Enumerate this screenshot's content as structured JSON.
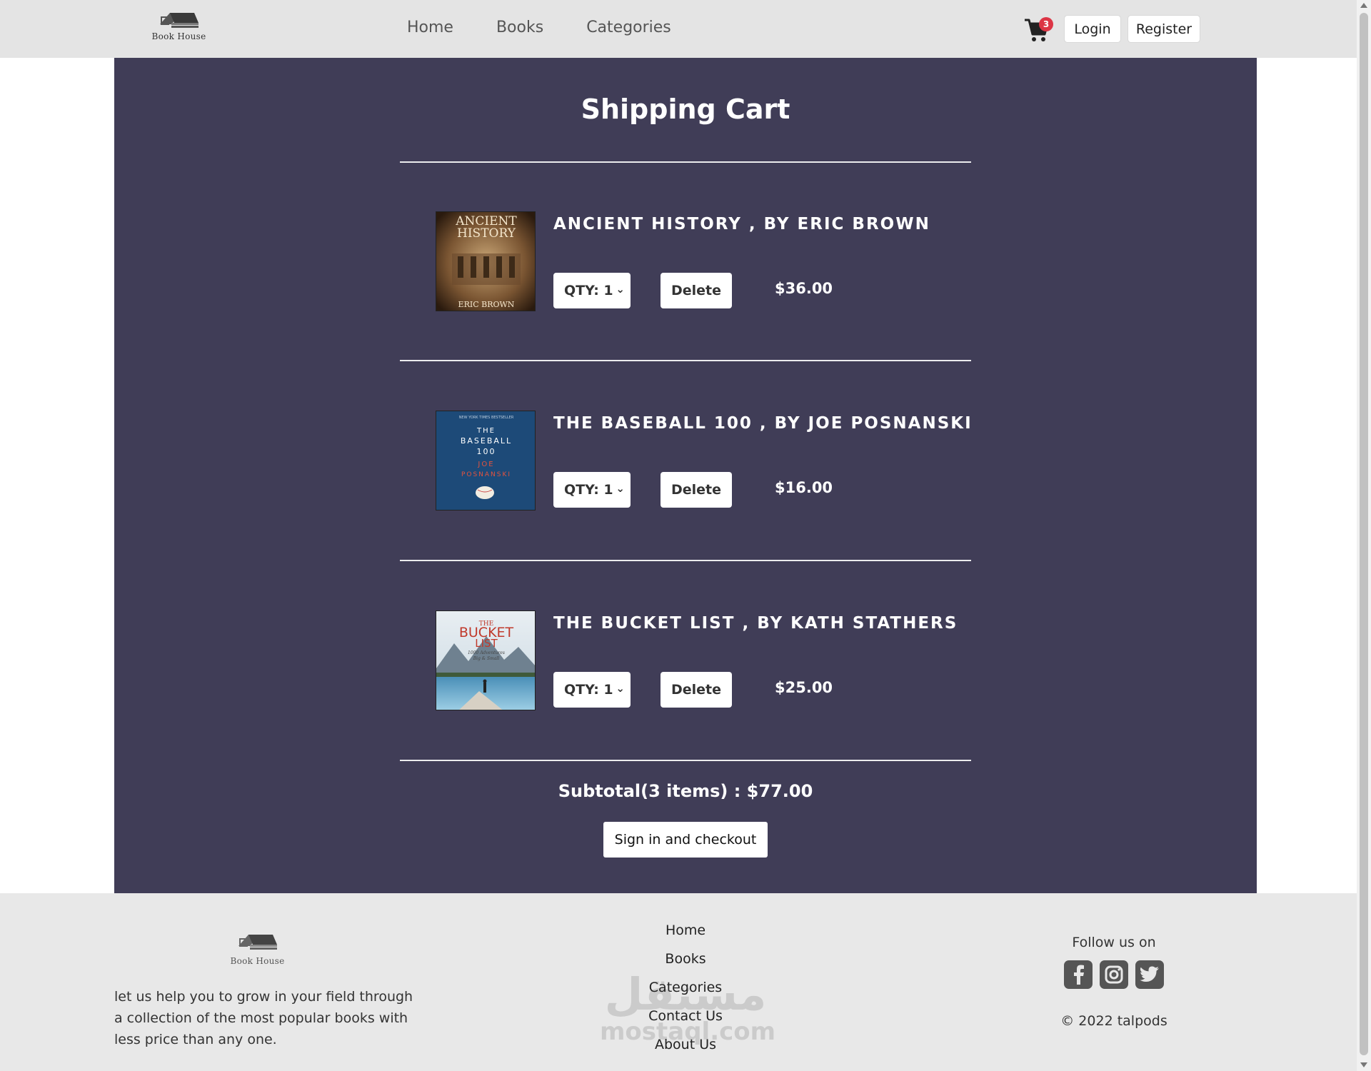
{
  "nav": {
    "brand": "Book House",
    "links": [
      "Home",
      "Books",
      "Categories"
    ],
    "cart_count": "3",
    "login_label": "Login",
    "register_label": "Register"
  },
  "cart": {
    "title": "Shipping Cart",
    "items": [
      {
        "title": "Ancient History , by Eric Brown",
        "qty_label": "QTY: 1",
        "delete_label": "Delete",
        "price": "$36.00",
        "cover": {
          "line1": "ANCIENT",
          "line2": "HISTORY",
          "author": "ERIC BROWN"
        }
      },
      {
        "title": "The Baseball 100 , by Joe Posnanski",
        "qty_label": "QTY: 1",
        "delete_label": "Delete",
        "price": "$16.00",
        "cover": {
          "top": "NEW YORK TIMES BESTSELLER",
          "line1": "THE",
          "line2": "BASEBALL",
          "line3": "100",
          "author1": "JOE",
          "author2": "POSNANSKI"
        }
      },
      {
        "title": "The Bucket List , by Kath Stathers",
        "qty_label": "QTY: 1",
        "delete_label": "Delete",
        "price": "$25.00",
        "cover": {
          "line1": "THE",
          "line2": "BUCKET",
          "line3": "LIST",
          "sub1": "1000 Adventures",
          "sub2": "Big & Small"
        }
      }
    ],
    "subtotal": "Subtotal(3 items) : $77.00",
    "checkout_label": "Sign in and checkout"
  },
  "footer": {
    "brand": "Book House",
    "about": "let us help you to grow in your field through a collection of the most popular books with less price than any one.",
    "links": [
      "Home",
      "Books",
      "Categories",
      "Contact Us",
      "About Us"
    ],
    "follow": "Follow us on",
    "copyright": "© 2022 talpods",
    "watermark_ar": "مستقل",
    "watermark_en": "mostaql.com"
  },
  "colors": {
    "panel": "#403d57",
    "navbar": "#e4e4e4",
    "badge": "#dc3545"
  }
}
